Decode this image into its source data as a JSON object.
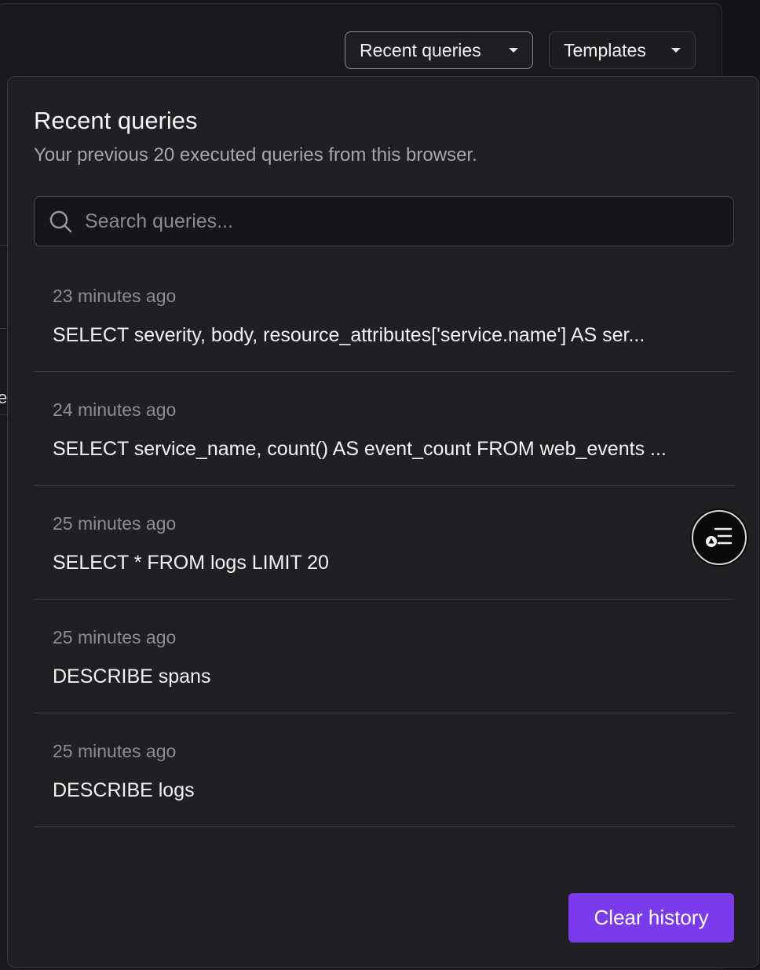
{
  "toolbar": {
    "recent_label": "Recent queries",
    "templates_label": "Templates"
  },
  "background": {
    "edge_glyph": "e"
  },
  "popover": {
    "title": "Recent queries",
    "subtitle": "Your previous 20 executed queries from this browser.",
    "search_placeholder": "Search queries...",
    "search_value": "",
    "items": [
      {
        "time": "23 minutes ago",
        "query": "SELECT severity, body, resource_attributes['service.name'] AS ser..."
      },
      {
        "time": "24 minutes ago",
        "query": "SELECT service_name, count() AS event_count FROM web_events ..."
      },
      {
        "time": "25 minutes ago",
        "query": "SELECT * FROM logs LIMIT 20"
      },
      {
        "time": "25 minutes ago",
        "query": "DESCRIBE spans"
      },
      {
        "time": "25 minutes ago",
        "query": "DESCRIBE logs"
      }
    ],
    "clear_label": "Clear history"
  },
  "colors": {
    "accent": "#7c3aed",
    "background": "#141416",
    "popover": "#202023"
  },
  "icons": {
    "search": "search-icon",
    "caret": "caret-down-icon",
    "fab": "list-filter-icon"
  }
}
